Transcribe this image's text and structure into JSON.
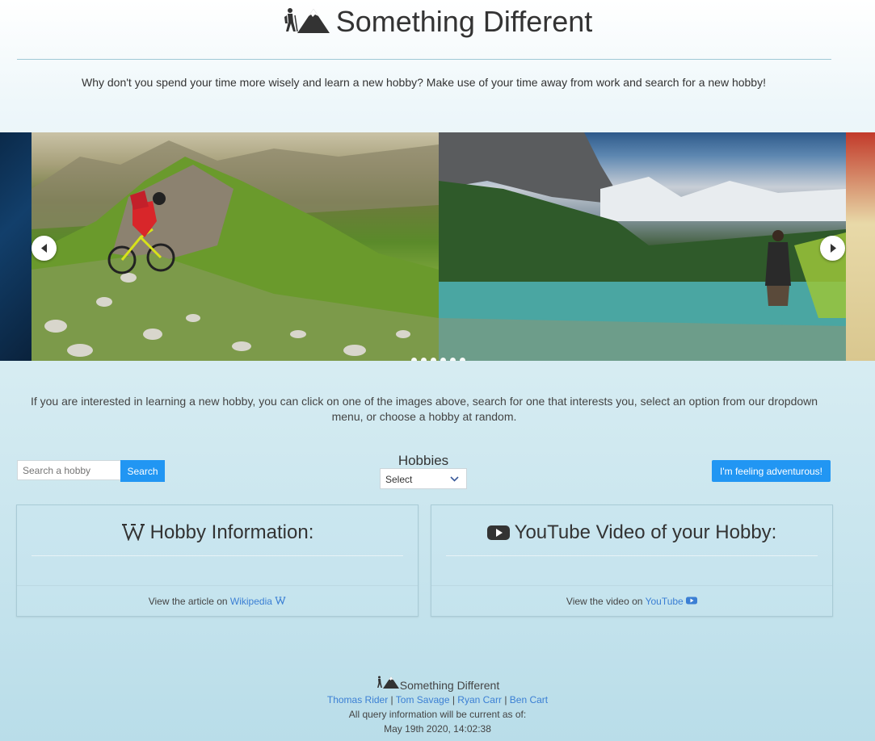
{
  "header": {
    "title": "Something Different",
    "intro": "Why don't you spend your time more wisely and learn a new hobby? Make use of your time away from work and search for a new hobby!"
  },
  "carousel": {
    "slide_count": 6,
    "prev_icon": "chevron-left-icon",
    "next_icon": "chevron-right-icon"
  },
  "lead_text": "If you are interested in learning a new hobby, you can click on one of the images above, search for one that interests you, select an option from our dropdown menu, or choose a hobby at random.",
  "search": {
    "placeholder": "Search a hobby",
    "button_label": "Search"
  },
  "hobbies": {
    "label": "Hobbies",
    "selected": "Select"
  },
  "random_button_label": "I'm feeling adventurous!",
  "cards": {
    "wiki": {
      "title": "Hobby Information:",
      "footer_prefix": "View the article on ",
      "link_text": "Wikipedia"
    },
    "youtube": {
      "title": "YouTube Video of your Hobby:",
      "footer_prefix": "View the video on ",
      "link_text": "YouTube"
    }
  },
  "footer": {
    "title": "Something Different",
    "authors": [
      "Thomas Rider",
      "Tom Savage",
      "Ryan Carr",
      "Ben Cart"
    ],
    "separator": " | ",
    "notice": "All query information will be current as of:",
    "timestamp": "May 19th 2020, 14:02:38"
  },
  "colors": {
    "accent": "#2196f3",
    "link": "#3b7fd4"
  }
}
